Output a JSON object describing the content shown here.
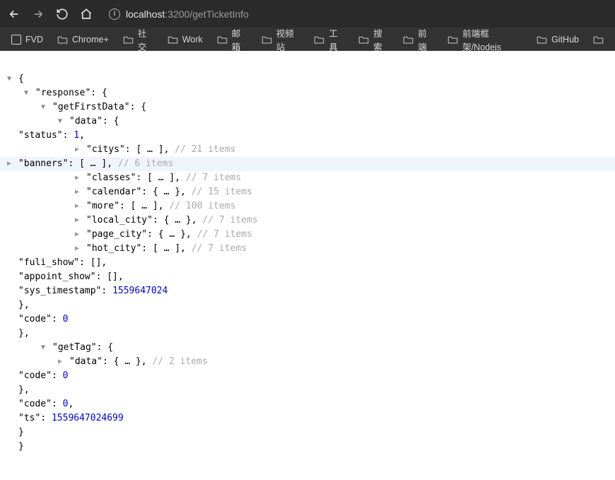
{
  "url": {
    "host": "localhost",
    "port": ":3200",
    "path": "/getTicketInfo"
  },
  "bookmarks": [
    "FVD",
    "Chrome+",
    "社交",
    "Work",
    "邮箱",
    "视频站",
    "工具",
    "搜索",
    "前端",
    "前端框架/Nodejs",
    "GitHub"
  ],
  "json": {
    "response": "response",
    "getFirstData": "getFirstData",
    "data": "data",
    "status_k": "status",
    "status_v": "1",
    "citys_k": "citys",
    "citys_c": "// 21 items",
    "banners_k": "banners",
    "banners_c": "// 6 items",
    "classes_k": "classes",
    "classes_c": "// 7 items",
    "calendar_k": "calendar",
    "calendar_c": "// 15 items",
    "more_k": "more",
    "more_c": "// 100 items",
    "local_city_k": "local_city",
    "local_city_c": "// 7 items",
    "page_city_k": "page_city",
    "page_city_c": "// 7 items",
    "hot_city_k": "hot_city",
    "hot_city_c": "// 7 items",
    "fuli_show_k": "fuli_show",
    "appoint_show_k": "appoint_show",
    "sys_timestamp_k": "sys_timestamp",
    "sys_timestamp_v": "1559647024",
    "code_k": "code",
    "code_v": "0",
    "getTag": "getTag",
    "getTag_data_c": "// 2 items",
    "ts_k": "ts",
    "ts_v": "1559647024699"
  }
}
